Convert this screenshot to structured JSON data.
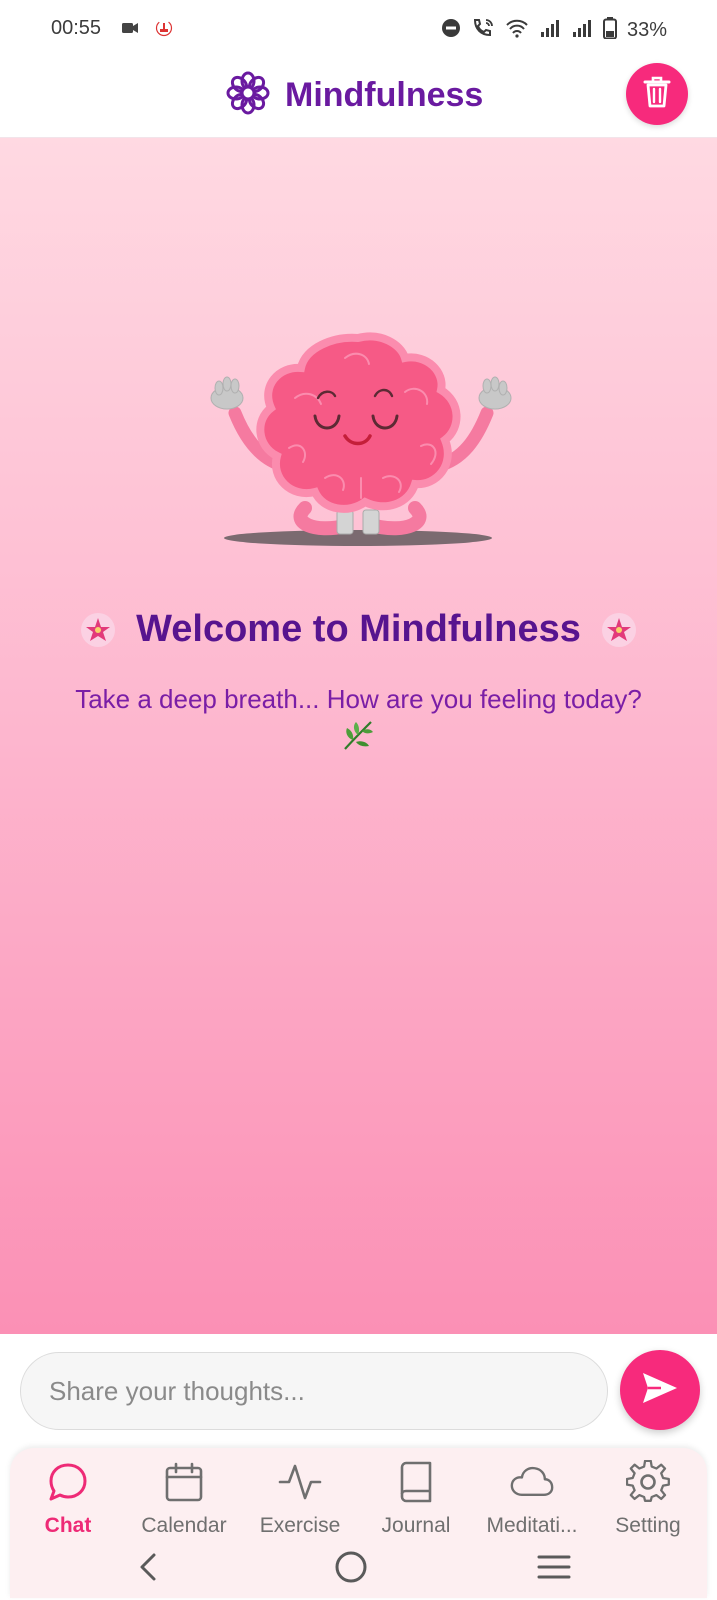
{
  "status_bar": {
    "time": "00:55",
    "battery": "33%",
    "icons": [
      "video-icon",
      "notification-icon",
      "dnd-icon",
      "wifi-call-icon",
      "wifi-icon",
      "signal-icon",
      "signal-icon",
      "battery-icon"
    ]
  },
  "header": {
    "title": "Mindfulness",
    "logo_icon": "flower-icon",
    "delete_icon": "trash-icon"
  },
  "welcome": {
    "title": "Welcome to Mindfulness",
    "subtitle": "Take a deep breath... How are you feeling today?",
    "leaf_emoji": "🌿"
  },
  "composer": {
    "placeholder": "Share your thoughts...",
    "value": "",
    "send_icon": "send-icon"
  },
  "nav": {
    "items": [
      {
        "label": "Chat",
        "icon": "chat-icon",
        "active": true
      },
      {
        "label": "Calendar",
        "icon": "calendar-icon",
        "active": false
      },
      {
        "label": "Exercise",
        "icon": "activity-icon",
        "active": false
      },
      {
        "label": "Journal",
        "icon": "book-icon",
        "active": false
      },
      {
        "label": "Meditati...",
        "icon": "cloud-icon",
        "active": false
      },
      {
        "label": "Setting",
        "icon": "gear-icon",
        "active": false
      }
    ]
  },
  "colors": {
    "accent": "#f72a7c",
    "title": "#6a1aa0",
    "gradient_top": "#ffd9e2",
    "gradient_bottom": "#fb90b5"
  }
}
